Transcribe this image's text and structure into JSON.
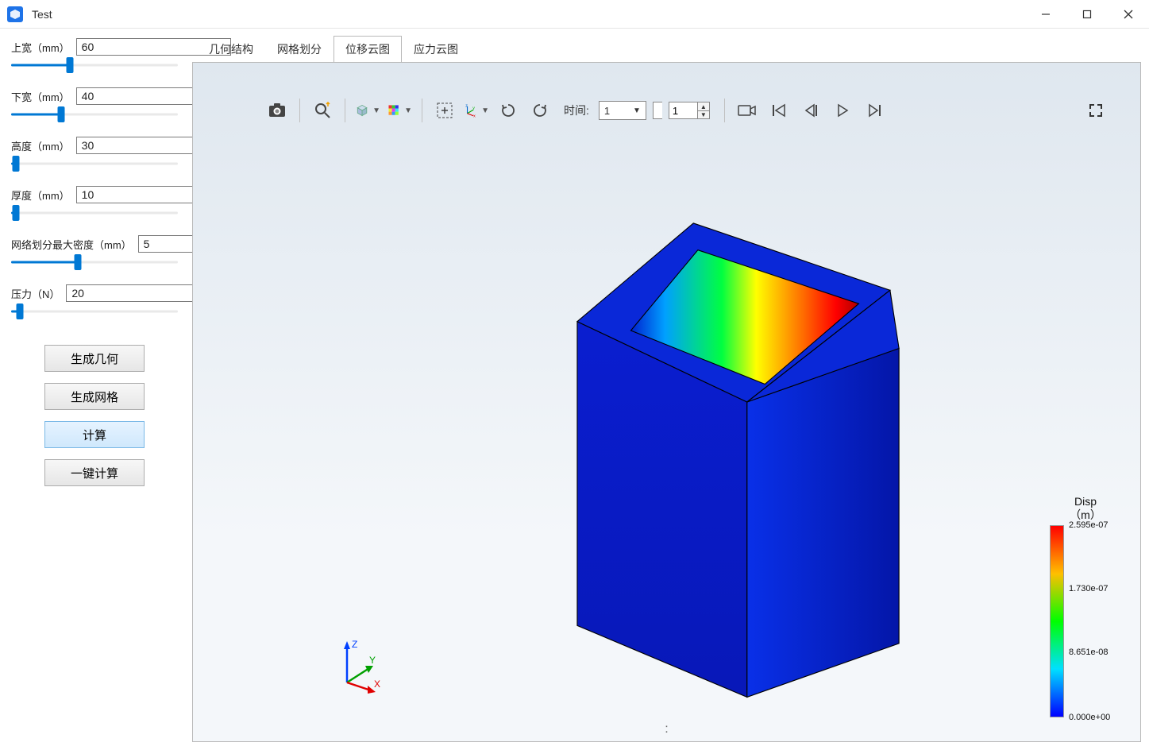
{
  "window": {
    "title": "Test"
  },
  "params": [
    {
      "label": "上宽（mm）",
      "value": "60",
      "fill_pct": 35
    },
    {
      "label": "下宽（mm）",
      "value": "40",
      "fill_pct": 30
    },
    {
      "label": "高度（mm）",
      "value": "30",
      "fill_pct": 3
    },
    {
      "label": "厚度（mm）",
      "value": "10",
      "fill_pct": 3
    },
    {
      "label": "网络划分最大密度（mm）",
      "value": "5",
      "fill_pct": 40
    },
    {
      "label": "压力（N）",
      "value": "20",
      "fill_pct": 5
    }
  ],
  "buttons": {
    "gen_geom": "生成几何",
    "gen_mesh": "生成网格",
    "compute": "计算",
    "one_click": "一键计算"
  },
  "tabs": [
    {
      "label": "几何结构",
      "active": false
    },
    {
      "label": "网格划分",
      "active": false
    },
    {
      "label": "位移云图",
      "active": true
    },
    {
      "label": "应力云图",
      "active": false
    }
  ],
  "toolbar": {
    "time_label": "时间:",
    "time_select": "1",
    "frame_value": "1"
  },
  "legend": {
    "title_line1": "Disp",
    "title_line2": "（m）",
    "ticks": [
      "2.595e-07",
      "1.730e-07",
      "8.651e-08",
      "0.000e+00"
    ]
  },
  "footer_marker": ":"
}
